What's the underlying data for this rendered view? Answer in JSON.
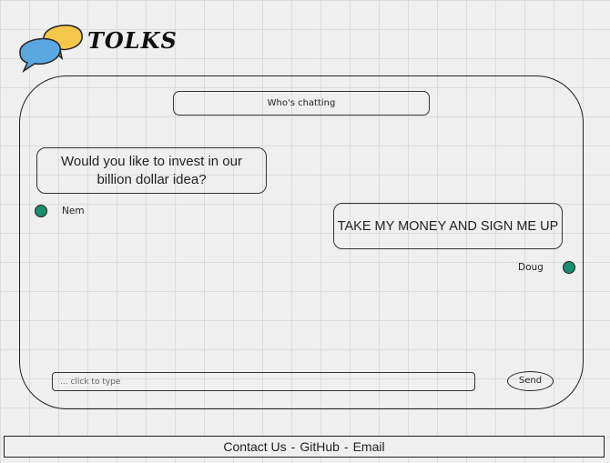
{
  "app": {
    "title": "TOLKS"
  },
  "chat": {
    "header": "Who's chatting",
    "messages": [
      {
        "sender": "Nem",
        "text": "Would you like to invest in our billion dollar idea?"
      },
      {
        "sender": "Doug",
        "text": "TAKE MY MONEY AND SIGN ME UP"
      }
    ],
    "input_placeholder": "... click to type",
    "send_label": "Send"
  },
  "footer": {
    "links": [
      "Contact Us",
      "GitHub",
      "Email"
    ],
    "separator": "-"
  },
  "colors": {
    "avatar": "#1a8e6f",
    "bubble_back": "#5ba8e0",
    "bubble_front": "#f4c64a"
  },
  "icons": {
    "logo": "speech-bubbles-icon"
  }
}
